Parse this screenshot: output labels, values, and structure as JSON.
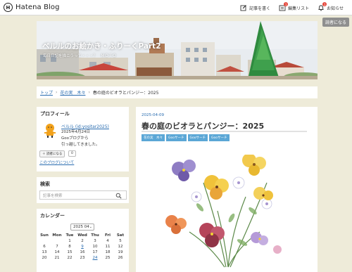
{
  "global_header": {
    "logo_text": "Hatena Blog",
    "logo_icon": "hatena-logo-icon",
    "nav": [
      {
        "label": "記事を書く",
        "icon": "pencil-icon"
      },
      {
        "label": "編集リスト",
        "icon": "list-icon",
        "badge": "1"
      },
      {
        "label": "お知らせ",
        "icon": "bell-icon",
        "badge": "1"
      }
    ]
  },
  "blog_header": {
    "title": "ベルルのお絵かき・ふりーくPart2",
    "description": "毎日日記を描こうって・・・？　ＭＯＴＯ",
    "reader_button": "読者になる"
  },
  "breadcrumb": {
    "items": [
      "トップ",
      "花の実　木々",
      "春の庭のビオラとパンジー：2025"
    ]
  },
  "sidebar": {
    "profile": {
      "title": "プロフィール",
      "name": "ベルル (id:yositar2025)",
      "text": "2025年4月24日\nGooブログから\n引っ越してきました。",
      "follow_button": "読者になる",
      "follow_count": "0",
      "about_link": "このブログについて"
    },
    "search": {
      "title": "検索",
      "placeholder": "記事を検索"
    },
    "calendar": {
      "title": "カレンダー",
      "month": "2025 04",
      "days_of_week": [
        "Sun",
        "Mon",
        "Tue",
        "Wed",
        "Thu",
        "Fri",
        "Sat"
      ],
      "weeks": [
        [
          "",
          "",
          "1",
          "2",
          "3",
          "4",
          "5"
        ],
        [
          "6",
          "7",
          "8",
          "9",
          "10",
          "11",
          "12"
        ],
        [
          "13",
          "14",
          "15",
          "16",
          "17",
          "18",
          "19"
        ],
        [
          "20",
          "21",
          "22",
          "23",
          "24",
          "25",
          "26"
        ]
      ],
      "linked_days": [
        "9",
        "24"
      ]
    }
  },
  "article": {
    "date": "2025-04-09",
    "title": "春の庭のビオラとパンジー：2025",
    "categories": [
      "花の実　木々",
      "Gooサーチ",
      "Gooサーチ",
      "Gooサーチ"
    ]
  },
  "colors": {
    "page_bg": "#eeebd9",
    "link": "#2a6db0",
    "category_bg": "#5ba7d6",
    "badge": "#e5463a"
  }
}
